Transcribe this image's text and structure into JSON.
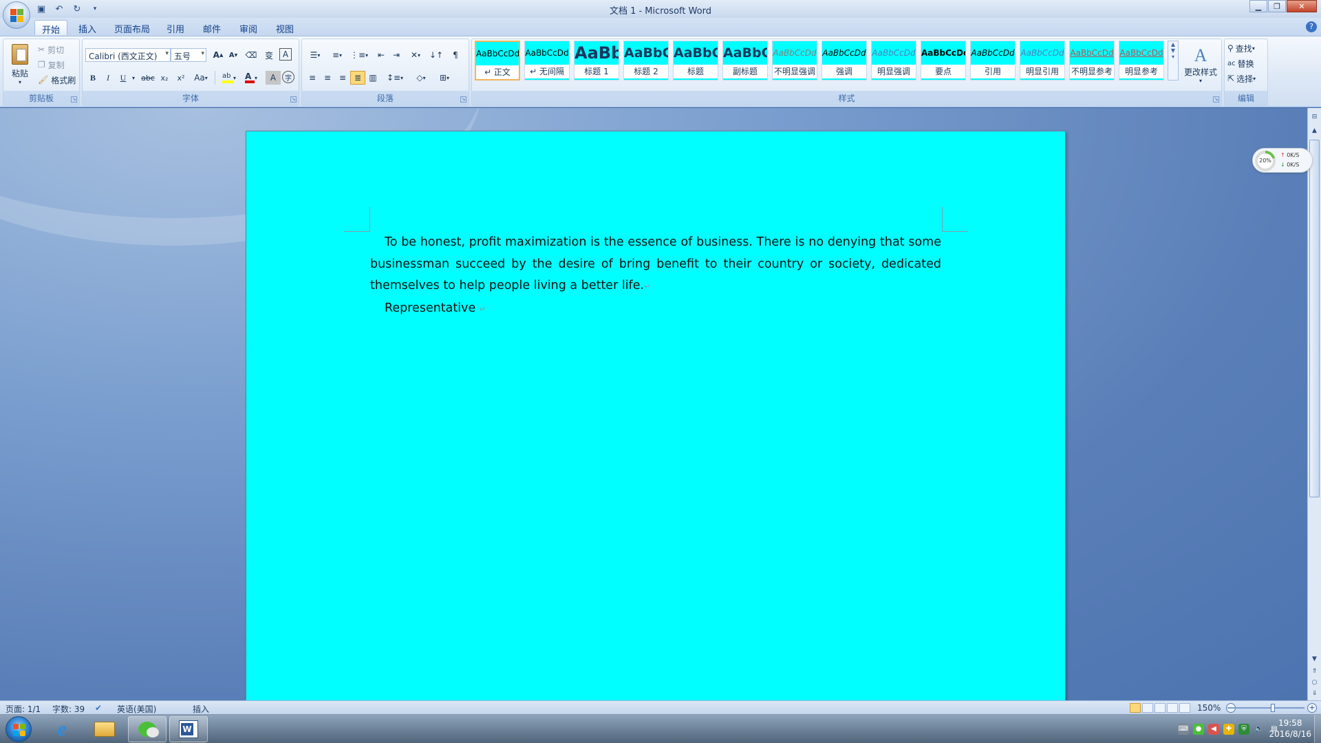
{
  "window": {
    "title": "文档 1 - Microsoft Word",
    "controls": [
      "minimize",
      "restore",
      "close"
    ]
  },
  "quick_access": [
    {
      "name": "save-icon",
      "glyph": "💾"
    },
    {
      "name": "undo-icon",
      "glyph": "↶"
    },
    {
      "name": "redo-icon",
      "glyph": "↻"
    },
    {
      "name": "customize-icon",
      "glyph": "▾"
    }
  ],
  "tabs": [
    {
      "label": "开始",
      "active": true
    },
    {
      "label": "插入"
    },
    {
      "label": "页面布局"
    },
    {
      "label": "引用"
    },
    {
      "label": "邮件"
    },
    {
      "label": "审阅"
    },
    {
      "label": "视图"
    }
  ],
  "ribbon": {
    "clipboard": {
      "label": "剪贴板",
      "paste": "粘贴",
      "cut": "剪切",
      "copy": "复制",
      "format_painter": "格式刷"
    },
    "font": {
      "label": "字体",
      "font_name": "Calibri (西文正文)",
      "font_size": "五号",
      "grow": "A",
      "shrink": "A",
      "bold": "B",
      "italic": "I",
      "underline": "U",
      "strike": "abc",
      "subscript": "x₂",
      "superscript": "x²",
      "case": "Aa",
      "font_color_letter": "A",
      "char_shade": "A",
      "enclose": "字",
      "phonetic": "变",
      "border_char": "A",
      "font_color": "#e00000",
      "highlight_color": "#ffff00"
    },
    "paragraph": {
      "label": "段落"
    },
    "styles": {
      "label": "样式",
      "change_styles": "更改样式",
      "items": [
        {
          "sample": "AaBbCcDd",
          "name": "↵ 正文",
          "selected": true
        },
        {
          "sample": "AaBbCcDd",
          "name": "↵ 无间隔"
        },
        {
          "sample": "AaBb",
          "name": "标题 1"
        },
        {
          "sample": "AaBbC",
          "name": "标题 2"
        },
        {
          "sample": "AaBbC",
          "name": "标题"
        },
        {
          "sample": "AaBbC",
          "name": "副标题"
        },
        {
          "sample": "AaBbCcDd",
          "name": "不明显强调"
        },
        {
          "sample": "AaBbCcDd",
          "name": "强调"
        },
        {
          "sample": "AaBbCcDd",
          "name": "明显强调"
        },
        {
          "sample": "AaBbCcDd",
          "name": "要点"
        },
        {
          "sample": "AaBbCcDd",
          "name": "引用"
        },
        {
          "sample": "AaBbCcDd",
          "name": "明显引用"
        },
        {
          "sample": "AaBbCcDd",
          "name": "不明显参考"
        },
        {
          "sample": "AaBbCcDd",
          "name": "明显参考"
        }
      ]
    },
    "editing": {
      "label": "编辑",
      "find": "查找",
      "replace": "替换",
      "select": "选择"
    }
  },
  "document": {
    "background": "#00ffff",
    "paragraph_1": "To be honest, profit maximization is the essence of business. There is no denying that some businessman succeed by the desire of bring benefit to their country or society, dedicated themselves to help people living a better life.",
    "paragraph_2": "Representative ",
    "para_mark": "↵"
  },
  "net_widget": {
    "percent": "20%",
    "up": "0K/S",
    "down": "0K/S"
  },
  "statusbar": {
    "page": "页面: 1/1",
    "words": "字数: 39",
    "language": "英语(美国)",
    "mode": "插入",
    "zoom": "150%"
  },
  "taskbar": {
    "apps": [
      "start",
      "internet-explorer",
      "file-explorer",
      "wechat",
      "word"
    ],
    "time": "19:58",
    "date": "2016/8/16"
  }
}
